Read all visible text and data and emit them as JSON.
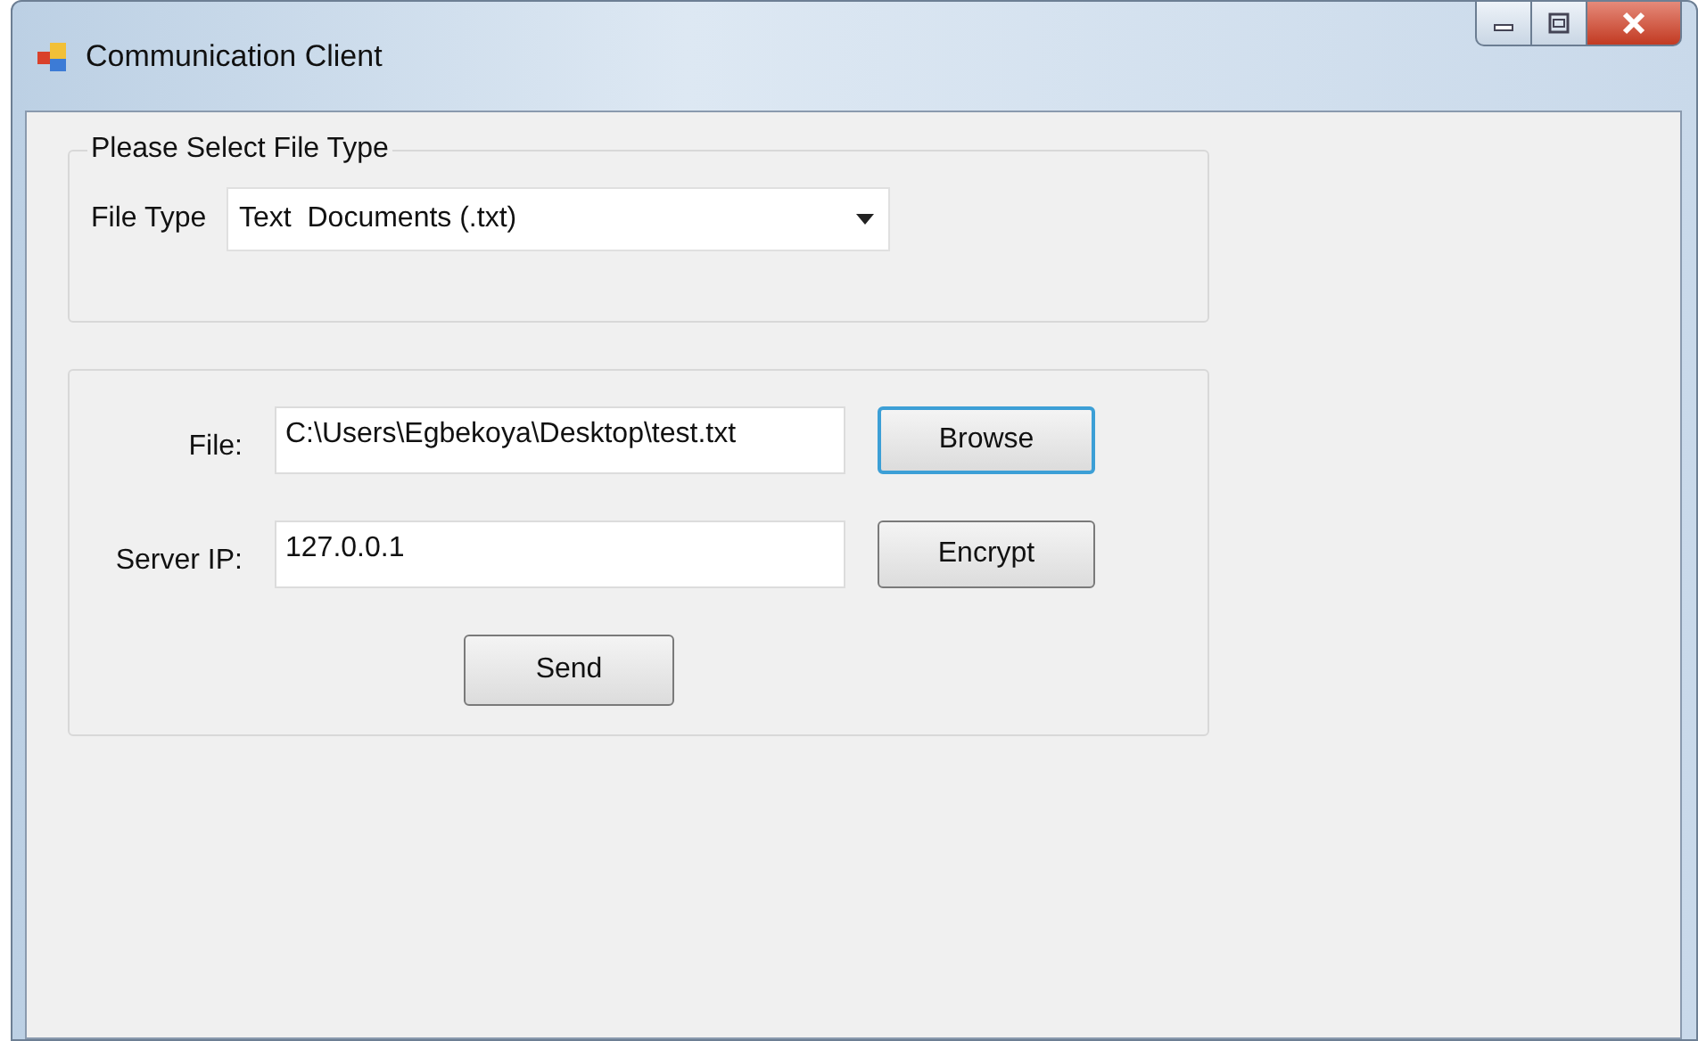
{
  "window": {
    "title": "Communication Client"
  },
  "file_type_group": {
    "title": "Please Select File Type",
    "label": "File Type",
    "value": "Text  Documents (.txt)"
  },
  "transfer_group": {
    "fields": [
      {
        "label": "File:",
        "value": "C:\\Users\\Egbekoya\\Desktop\\test.txt"
      },
      {
        "label": "Server IP:",
        "value": "127.0.0.1"
      }
    ],
    "buttons": [
      {
        "label": "Browse",
        "focused": true
      },
      {
        "label": "Encrypt",
        "focused": false
      }
    ],
    "send_button": {
      "label": "Send"
    }
  }
}
